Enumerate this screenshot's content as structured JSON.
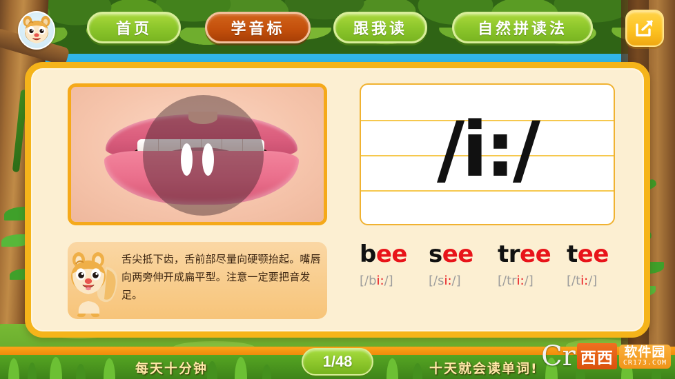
{
  "app": {
    "background_theme": "jungle-forest",
    "sky_color": "#29ABE2",
    "panel_border_color": "#F5B41A",
    "panel_bg_color": "#FCEFD2"
  },
  "topnav": {
    "avatar_name": "chipmunk-mascot-avatar",
    "items": [
      {
        "label": "首页",
        "name": "nav-home",
        "active": false,
        "color": "#8CC62B"
      },
      {
        "label": "学音标",
        "name": "nav-phonics",
        "active": true,
        "color": "#C4500C"
      },
      {
        "label": "跟我读",
        "name": "nav-read",
        "active": false,
        "color": "#8CC62B"
      },
      {
        "label": "自然拼读法",
        "name": "nav-natural",
        "active": false,
        "color": "#8CC62B"
      }
    ],
    "share_icon": "share-arrow-icon",
    "share_color": "#FDC322"
  },
  "lesson": {
    "mouth_image_alt": "mouth-articulation-photo",
    "phonetic_symbol": "/i:/",
    "tip_text": "舌尖抵下齿，舌前部尽量向硬颚抬起。嘴唇向两旁伸开成扁平型。注意一定要把音发足。",
    "tip_mascot": "chipmunk-mascot",
    "highlight_color": "#E8141A",
    "ipa_color": "#9C9C9C",
    "words": [
      {
        "prefix": "b",
        "highlight": "ee",
        "ipa_prefix": "[/b",
        "ipa_highlight": "i:",
        "ipa_suffix": "/]"
      },
      {
        "prefix": "s",
        "highlight": "ee",
        "ipa_prefix": "[/s",
        "ipa_highlight": "i:",
        "ipa_suffix": "/]"
      },
      {
        "prefix": "tr",
        "highlight": "ee",
        "ipa_prefix": "[/tr",
        "ipa_highlight": "i:",
        "ipa_suffix": "/]"
      },
      {
        "prefix": "t",
        "highlight": "ee",
        "ipa_prefix": "[/t",
        "ipa_highlight": "i:",
        "ipa_suffix": "/]"
      }
    ]
  },
  "bottombar": {
    "left_text": "每天十分钟",
    "right_text": "十天就会读单词!",
    "page_indicator": "1/48",
    "badge_color": "#8CC62B"
  },
  "watermark": {
    "cr": "Cr",
    "brand_cn": "西西",
    "site_cn": "软件园",
    "site_url": "CR173.COM"
  }
}
